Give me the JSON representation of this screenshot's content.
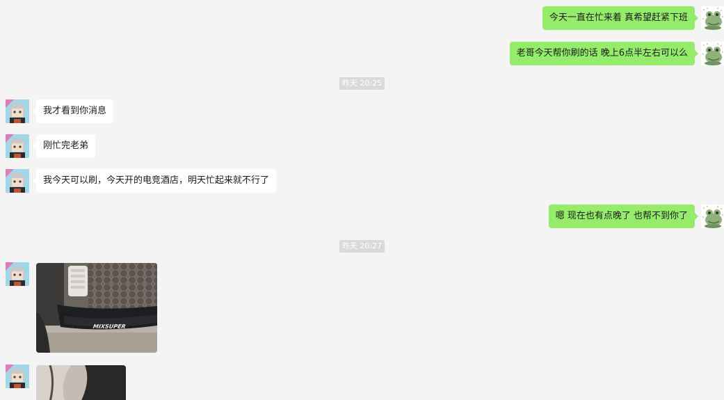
{
  "messages": [
    {
      "id": "m1",
      "direction": "out",
      "text": "今天一直在忙来着 真希望赶紧下班",
      "avatar": "frog-avatar"
    },
    {
      "id": "m2",
      "direction": "out",
      "text": "老哥今天帮你刷的话 晚上6点半左右可以么",
      "avatar": "frog-avatar"
    },
    {
      "id": "t1",
      "type": "timestamp",
      "text": "昨天 20:25"
    },
    {
      "id": "m3",
      "direction": "in",
      "text": "我才看到你消息",
      "avatar": "gray-hair-avatar"
    },
    {
      "id": "m4",
      "direction": "in",
      "text": "刚忙完老弟",
      "avatar": "gray-hair-avatar"
    },
    {
      "id": "m5",
      "direction": "in",
      "text": "我今天可以刷，今天开的电竞酒店，明天忙起来就不行了",
      "avatar": "gray-hair-avatar"
    },
    {
      "id": "m6",
      "direction": "out",
      "text": "嗯 现在也有点晚了 也帮不到你了",
      "avatar": "frog-avatar"
    },
    {
      "id": "t2",
      "type": "timestamp",
      "text": "昨天 20:27"
    },
    {
      "id": "m7",
      "direction": "in",
      "type": "image",
      "alt": "car-front-bumper-photo",
      "photo_text": "MIXSUPER",
      "avatar": "gray-hair-avatar"
    },
    {
      "id": "m8",
      "direction": "in",
      "type": "image",
      "alt": "car-closeup-photo",
      "avatar": "gray-hair-avatar"
    }
  ],
  "colors": {
    "background": "#f4f4f4",
    "incoming_bubble": "#ffffff",
    "outgoing_bubble": "#95ec69",
    "timestamp_bg": "#dadada",
    "timestamp_text": "#ffffff"
  }
}
